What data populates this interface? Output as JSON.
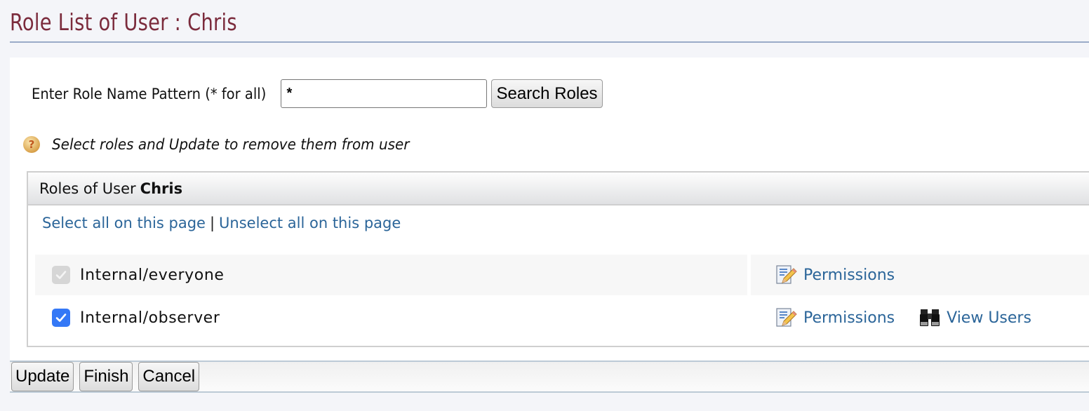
{
  "page": {
    "title": "Role List of User : Chris"
  },
  "search": {
    "label": "Enter Role Name Pattern (* for all)",
    "value": "*",
    "button_label": "Search Roles"
  },
  "help": {
    "icon": "help-icon",
    "text": "Select roles and Update to remove them from user"
  },
  "roles_panel": {
    "header_prefix": "Roles of User",
    "user_name": "Chris",
    "select_all_label": "Select all on this page",
    "separator": "|",
    "unselect_all_label": "Unselect all on this page",
    "rows": [
      {
        "name": "Internal/everyone",
        "checked": true,
        "disabled": true,
        "actions": [
          {
            "icon": "edit-permissions-icon",
            "label": "Permissions"
          }
        ]
      },
      {
        "name": "Internal/observer",
        "checked": true,
        "disabled": false,
        "actions": [
          {
            "icon": "edit-permissions-icon",
            "label": "Permissions"
          },
          {
            "icon": "binoculars-icon",
            "label": "View Users"
          }
        ]
      }
    ]
  },
  "footer": {
    "update_label": "Update",
    "finish_label": "Finish",
    "cancel_label": "Cancel"
  },
  "colors": {
    "title": "#7b2b3c",
    "link": "#2b6599",
    "checkbox_checked": "#3478f6",
    "checkbox_disabled": "#d6d6d6",
    "background": "#f4f5f9"
  }
}
